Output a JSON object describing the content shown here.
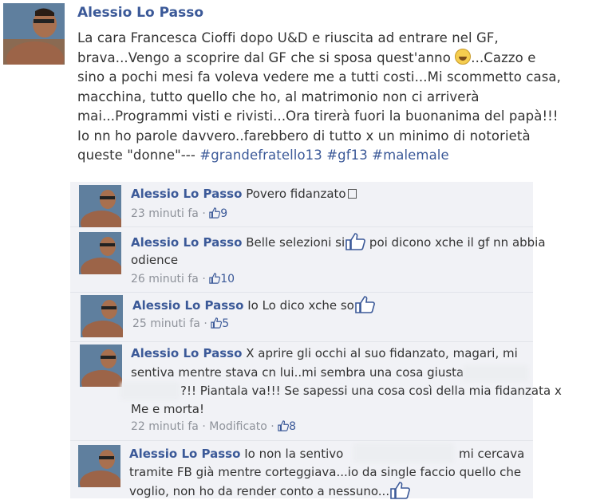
{
  "post": {
    "author": "Alessio Lo Passo",
    "lines": [
      "La cara Francesca Cioffi dopo U&D e riuscita ad entrare nel GF,",
      "brava...Vengo a scoprire dal GF che si sposa quest'anno",
      "...Cazzo e",
      "sino a pochi mesi fa voleva vedere me a tutti costi...Mi scommetto casa,",
      "macchina, tutto quello che ho, al matrimonio non ci arriverà",
      "mai...Programmi visti e rivisti...Ora tirerà fuori la buonanima del papà!!!",
      "Io nn ho parole davvero..farebbero di tutto x un minimo di notorietà",
      "queste \"donne\"---"
    ],
    "hashtags": [
      "#grandefratello13",
      "#gf13",
      "#malemale"
    ]
  },
  "comments": [
    {
      "author": "Alessio Lo Passo",
      "text": "Povero fidanzato",
      "time": "23 minuti fa",
      "likes": "9"
    },
    {
      "author": "Alessio Lo Passo",
      "text_a": "Belle selezioni si",
      "text_b": "poi dicono xche il gf nn abbia",
      "text_c": "odience",
      "time": "26 minuti fa",
      "likes": "10"
    },
    {
      "author": "Alessio Lo Passo",
      "text": "Io Lo dico xche so",
      "time": "25 minuti fa",
      "likes": "5"
    },
    {
      "author": "Alessio Lo Passo",
      "text_a": "X aprire gli occhi al suo fidanzato, magari, mi",
      "text_b": "sentiva mentre stava cn lui..mi sembra una cosa giusta",
      "text_c": "?!! Piantala va!!! Se sapessi una cosa così della mia fidanzata x",
      "text_d": "Me e morta!",
      "time": "22 minuti fa",
      "edited": "Modificato",
      "likes": "8"
    },
    {
      "author": "Alessio Lo Passo",
      "text_a": "Io non la sentivo",
      "text_b": "mi cercava",
      "text_c": "tramite FB già mentre corteggiava...io da single faccio quello che",
      "text_d": "voglio, non ho da render conto a nessuno..."
    }
  ],
  "ui": {
    "dot": " · ",
    "like_icon": "thumbs-up-icon",
    "link_color": "#3b5998",
    "comment_bg": "#f1f2f6"
  }
}
